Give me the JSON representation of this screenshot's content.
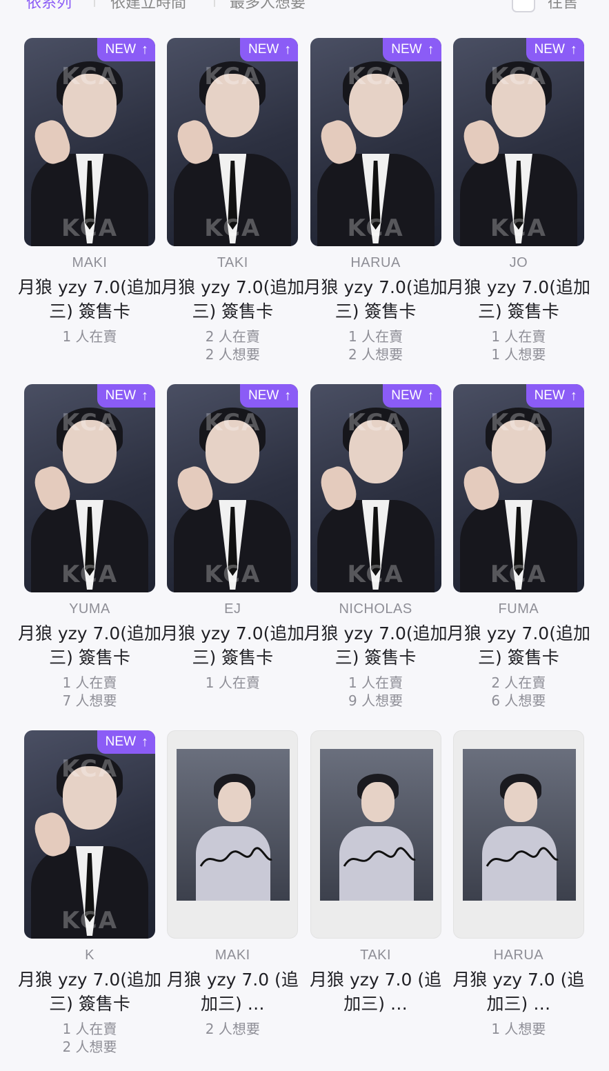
{
  "sort_bar": {
    "options": [
      "依系列",
      "依建立時間",
      "最多人想要"
    ],
    "active_index": 0,
    "checkbox_label": "往售"
  },
  "cards": [
    {
      "member": "MAKI",
      "title": "月狼 yzy 7.0(追加三) 簽售卡",
      "badge": "NEW",
      "selling": "1 人在賣",
      "wanting": "",
      "style": "photo"
    },
    {
      "member": "TAKI",
      "title": "月狼 yzy 7.0(追加三) 簽售卡",
      "badge": "NEW",
      "selling": "2 人在賣",
      "wanting": "2 人想要",
      "style": "photo"
    },
    {
      "member": "HARUA",
      "title": "月狼 yzy 7.0(追加三) 簽售卡",
      "badge": "NEW",
      "selling": "1 人在賣",
      "wanting": "2 人想要",
      "style": "photo"
    },
    {
      "member": "JO",
      "title": "月狼 yzy 7.0(追加三) 簽售卡",
      "badge": "NEW",
      "selling": "1 人在賣",
      "wanting": "1 人想要",
      "style": "photo"
    },
    {
      "member": "YUMA",
      "title": "月狼 yzy 7.0(追加三) 簽售卡",
      "badge": "NEW",
      "selling": "1 人在賣",
      "wanting": "7 人想要",
      "style": "photo"
    },
    {
      "member": "EJ",
      "title": "月狼 yzy 7.0(追加三) 簽售卡",
      "badge": "NEW",
      "selling": "1 人在賣",
      "wanting": "",
      "style": "photo"
    },
    {
      "member": "NICHOLAS",
      "title": "月狼 yzy 7.0(追加三) 簽售卡",
      "badge": "NEW",
      "selling": "1 人在賣",
      "wanting": "9 人想要",
      "style": "photo"
    },
    {
      "member": "FUMA",
      "title": "月狼 yzy 7.0(追加三) 簽售卡",
      "badge": "NEW",
      "selling": "2 人在賣",
      "wanting": "6 人想要",
      "style": "photo"
    },
    {
      "member": "K",
      "title": "月狼 yzy 7.0(追加三) 簽售卡",
      "badge": "NEW",
      "selling": "1 人在賣",
      "wanting": "2 人想要",
      "style": "photo"
    },
    {
      "member": "MAKI",
      "title": "月狼 yzy 7.0 (追加三) …",
      "badge": "",
      "selling": "2 人想要",
      "wanting": "",
      "style": "polaroid"
    },
    {
      "member": "TAKI",
      "title": "月狼 yzy 7.0 (追加三) …",
      "badge": "",
      "selling": "",
      "wanting": "",
      "style": "polaroid"
    },
    {
      "member": "HARUA",
      "title": "月狼 yzy 7.0 (追加三) …",
      "badge": "",
      "selling": "1 人想要",
      "wanting": "",
      "style": "polaroid"
    }
  ],
  "watermark_text": "KCA",
  "colors": {
    "accent": "#8b5cf6",
    "muted": "#8e8e96",
    "background": "#f7f7fa"
  },
  "icons": {
    "badge_arrow": "arrow-up-icon"
  }
}
